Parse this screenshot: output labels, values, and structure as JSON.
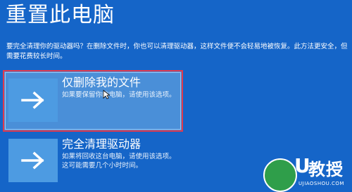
{
  "title": "重置此电脑",
  "description": "要完全清理你的驱动器吗？在删除文件时，你也可以清理驱动器，这样文件便不会轻易地被恢复。此方法更安全，但需要花费较长时间。",
  "options": [
    {
      "title": "仅删除我的文件",
      "subtitle": "如果要保留你的电脑，请使用该选项。",
      "icon": "arrow-right-icon",
      "selected": true
    },
    {
      "title": "完全清理驱动器",
      "subtitle": "如果将回收这台电脑，请使用该选项。这可能需要几个小时时间。",
      "icon": "arrow-right-icon",
      "selected": false
    }
  ],
  "watermark": {
    "logo_letter": "U",
    "text": "教授",
    "url": "UJIAOSHOU.COM"
  },
  "colors": {
    "background": "#1565c8",
    "tile": "#4d9be2",
    "selected_bg": "#4a8fd8",
    "selected_border": "#e03a4e"
  }
}
